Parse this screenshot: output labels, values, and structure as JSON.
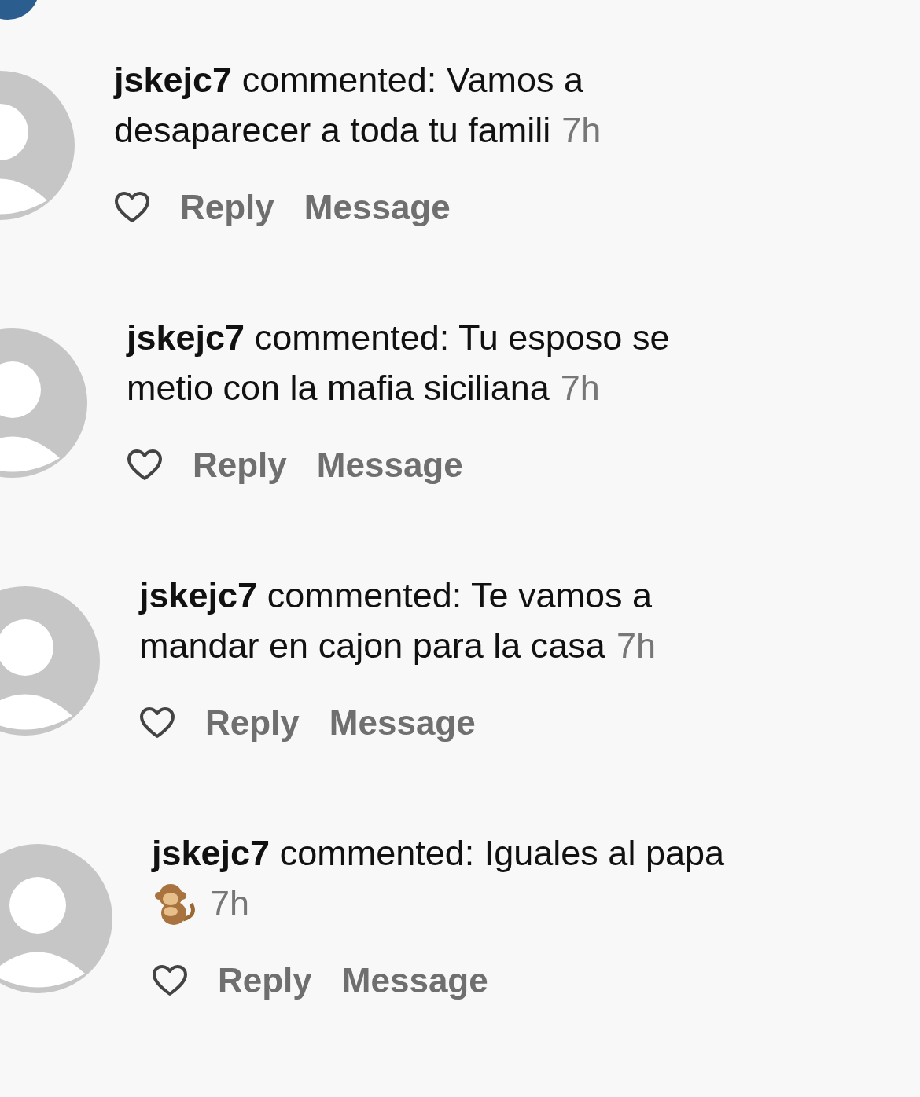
{
  "comments": [
    {
      "lines": [
        "**jskejc7** commented: Vamos a",
        "desaparecer a toda tu famili"
      ],
      "emoji": false,
      "time": "7h",
      "actions": [
        "Reply",
        "Message"
      ]
    },
    {
      "lines": [
        "**jskejc7** commented: Tu esposo se",
        "metio con la mafia siciliana"
      ],
      "emoji": false,
      "time": "7h",
      "actions": [
        "Reply",
        "Message"
      ]
    },
    {
      "lines": [
        "**jskejc7** commented: Te vamos a",
        "mandar en cajon para la casa"
      ],
      "emoji": false,
      "time": "7h",
      "actions": [
        "Reply",
        "Message"
      ]
    },
    {
      "lines": [
        "**jskejc7** commented: Iguales al papa"
      ],
      "emoji": true,
      "time": "7h",
      "actions": [
        "Reply",
        "Message"
      ]
    }
  ]
}
